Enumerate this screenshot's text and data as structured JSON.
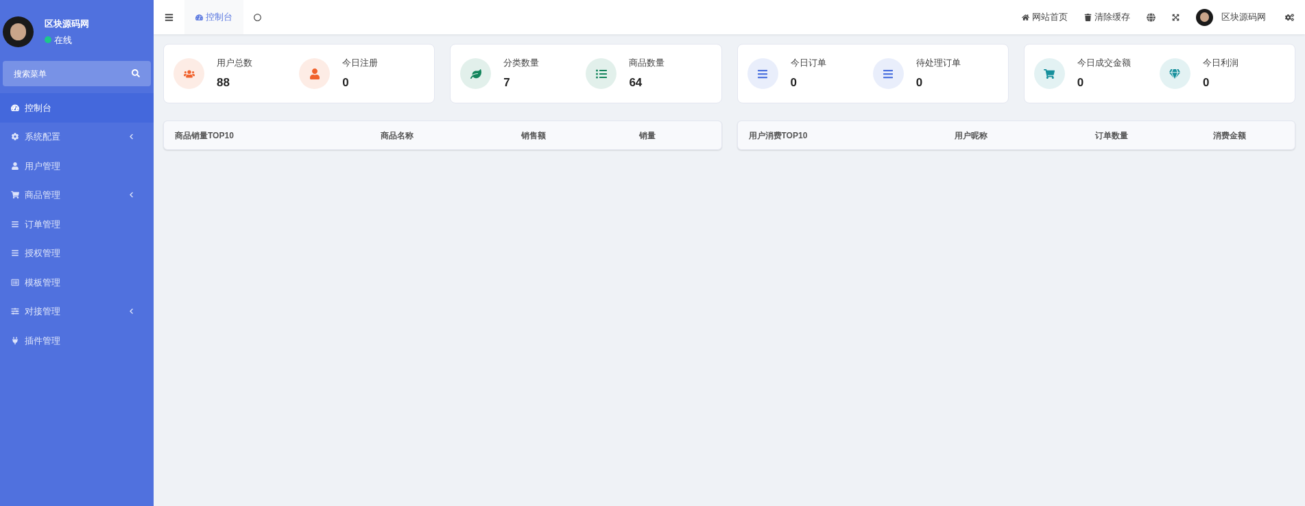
{
  "sidebar": {
    "user": {
      "name": "区块源码网",
      "status": "在线",
      "online": true
    },
    "search": {
      "placeholder": "搜索菜单"
    },
    "items": [
      {
        "label": "控制台",
        "selected": true,
        "has_submenu": false
      },
      {
        "label": "系统配置",
        "selected": false,
        "has_submenu": true
      },
      {
        "label": "用户管理",
        "selected": false,
        "has_submenu": false
      },
      {
        "label": "商品管理",
        "selected": false,
        "has_submenu": true
      },
      {
        "label": "订单管理",
        "selected": false,
        "has_submenu": false
      },
      {
        "label": "授权管理",
        "selected": false,
        "has_submenu": false
      },
      {
        "label": "模板管理",
        "selected": false,
        "has_submenu": false
      },
      {
        "label": "对接管理",
        "selected": false,
        "has_submenu": true
      },
      {
        "label": "插件管理",
        "selected": false,
        "has_submenu": false
      }
    ]
  },
  "tabs": [
    {
      "label": "控制台",
      "selected": true
    }
  ],
  "header_links": [
    {
      "label": "网站首页"
    },
    {
      "label": "清除缓存"
    }
  ],
  "header_user": {
    "name": "区块源码网"
  },
  "stat_cards": [
    {
      "stats": [
        {
          "label": "用户总数",
          "value": "88",
          "color": "#f0622d"
        },
        {
          "label": "今日注册",
          "value": "0",
          "color": "#f0622d"
        }
      ]
    },
    {
      "stats": [
        {
          "label": "分类数量",
          "value": "7",
          "color": "#13855c"
        },
        {
          "label": "商品数量",
          "value": "64",
          "color": "#13855c"
        }
      ]
    },
    {
      "stats": [
        {
          "label": "今日订单",
          "value": "0",
          "color": "#4e73df"
        },
        {
          "label": "待处理订单",
          "value": "0",
          "color": "#4e73df"
        }
      ]
    },
    {
      "stats": [
        {
          "label": "今日成交金额",
          "value": "0",
          "color": "#17909c"
        },
        {
          "label": "今日利润",
          "value": "0",
          "color": "#17909c"
        }
      ]
    }
  ],
  "tables": [
    {
      "columns": [
        "商品销量TOP10",
        "商品名称",
        "销售额",
        "销量"
      ]
    },
    {
      "columns": [
        "用户消费TOP10",
        "用户昵称",
        "订单数量",
        "消费金额"
      ]
    }
  ]
}
